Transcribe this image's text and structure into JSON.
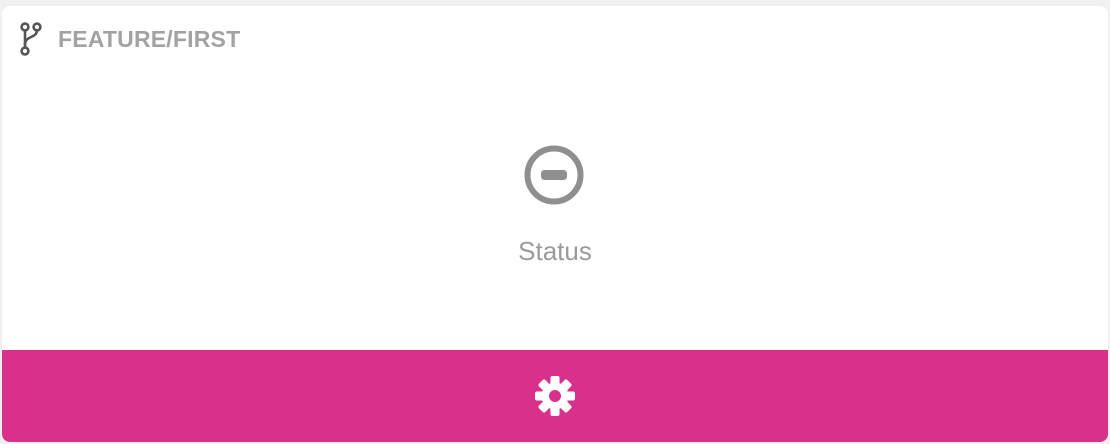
{
  "header": {
    "branch_icon": "git-branch-icon",
    "branch_name": "FEATURE/FIRST"
  },
  "status": {
    "icon": "minus-circle-icon",
    "label": "Status"
  },
  "footer": {
    "icon": "gear-icon"
  },
  "colors": {
    "accent": "#d9318a",
    "header_text": "#a2a2a2",
    "status_text": "#9a9a9a",
    "status_icon": "#8f8f8f",
    "branch_icon": "#555555"
  }
}
